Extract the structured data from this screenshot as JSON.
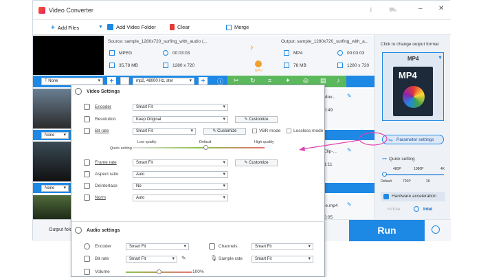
{
  "app": {
    "title": "Video Converter"
  },
  "toolbar": {
    "add_files": "Add Files",
    "add_video_folder": "Add Video Folder",
    "clear": "Clear",
    "merge": "Merge"
  },
  "file1": {
    "source": "Source: sample_1280x720_surfing_with_audio (...",
    "output": "Output: sample_1280x720_surfing_with_a...",
    "src_format": "MPEG",
    "src_duration": "00:03:03",
    "src_size": "35.78 MB",
    "src_res": "1280 x 720",
    "out_format": "MP4",
    "out_duration": "00:03:03",
    "out_size": "78 MB",
    "out_res": "1280 x 720",
    "gpu": "GPU"
  },
  "subtitle": {
    "value": "None"
  },
  "audio_track": {
    "value": "mp2, 48000 Hz, ster"
  },
  "row2": {
    "subtitle": "None",
    "name": "...n-Mov...",
    "time": "...0:49"
  },
  "row3": {
    "subtitle": "None",
    "name": "...e-Clip-...",
    "time": "...1:11"
  },
  "row4": {
    "name": "...e.mp4",
    "time": "...0:05"
  },
  "output_folder": {
    "label": "Output fold"
  },
  "run": {
    "label": "Run"
  },
  "right": {
    "hint": "Click to change output format",
    "format": "MP4",
    "thumb_text": "MP4",
    "param_btn": "Parameter settings",
    "quick": "Quick setting",
    "ticks_top": [
      "480P",
      "1080P",
      "4K"
    ],
    "ticks_bottom": [
      "Default",
      "720P",
      "2K"
    ],
    "hw": "Hardware acceleration",
    "nvidia": "NVIDIA",
    "intel": "Intel"
  },
  "video": {
    "title": "Video Settings",
    "encoder": "Encoder",
    "encoder_v": "Smart Fit",
    "resolution": "Resolution",
    "resolution_v": "Keep Original",
    "customize": "Customize",
    "bitrate": "Bit rate",
    "bitrate_v": "Smart Fit",
    "vbr": "VBR mode",
    "lossless": "Lossless mode",
    "quick": "Quick setting",
    "low": "Low quality",
    "default": "Default",
    "high": "High quality",
    "framerate": "Frame rate",
    "framerate_v": "Smart Fit",
    "aspect": "Aspect ratio",
    "aspect_v": "Auto",
    "deinterlace": "Deinterlace",
    "deinterlace_v": "No",
    "norm": "Norm",
    "norm_v": "Auto"
  },
  "audio": {
    "title": "Audio settings",
    "encoder": "Encoder",
    "encoder_v": "Smart Fit",
    "bitrate": "Bit rate",
    "bitrate_v": "Smart Fit",
    "channels": "Channels",
    "channels_v": "Smart Fit",
    "sample": "Sample rate",
    "sample_v": "Smart Fit",
    "volume": "Volume",
    "volume_v": "100%"
  },
  "colors": {
    "accent": "#1e88e5",
    "green": "#5cb85c",
    "annotation": "#e040b0"
  }
}
